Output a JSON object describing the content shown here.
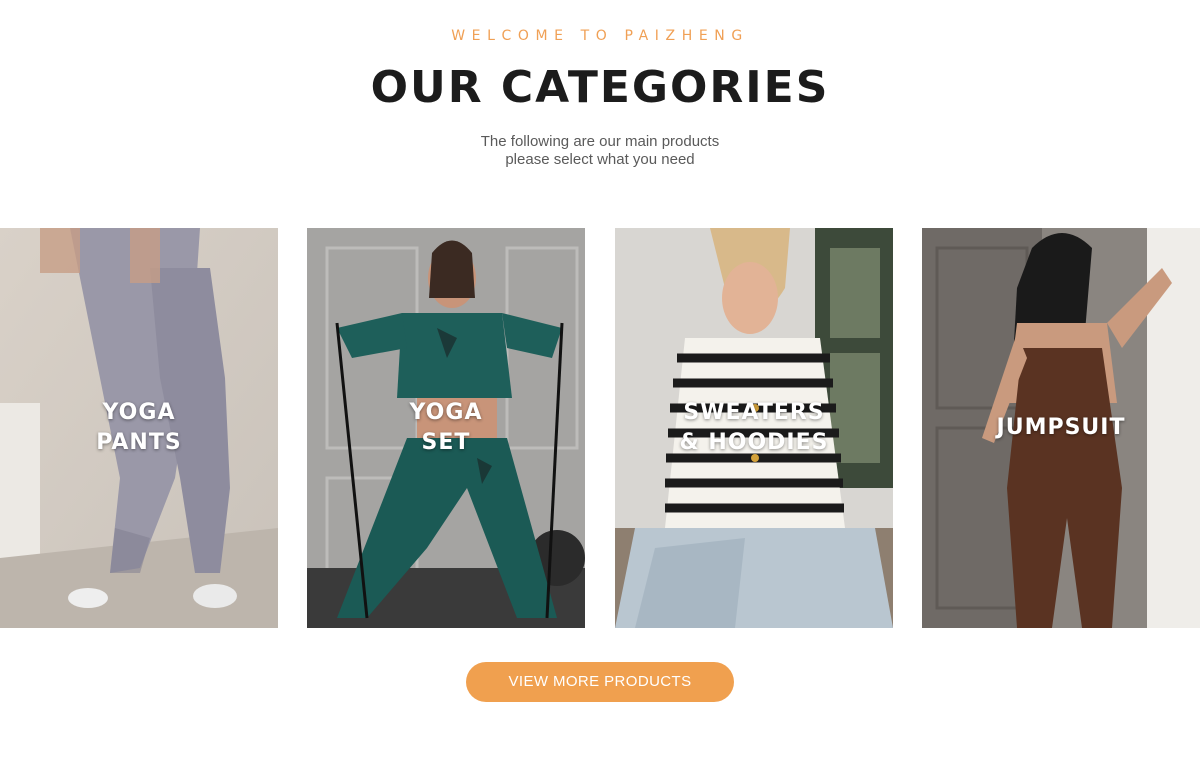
{
  "header": {
    "eyebrow": "WELCOME TO PAIZHENG",
    "title": "OUR CATEGORIES",
    "subtitle_line1": "The following are our main products",
    "subtitle_line2": "please select what you need"
  },
  "categories": [
    {
      "line1": "YOGA",
      "line2": "PANTS"
    },
    {
      "line1": "YOGA",
      "line2": "SET"
    },
    {
      "line1": "SWEATERS",
      "line2": "& HOODIES"
    },
    {
      "line1": "JUMPSUIT"
    }
  ],
  "cta": {
    "label": "VIEW MORE PRODUCTS"
  },
  "colors": {
    "accent": "#f0a04f",
    "title": "#1c1c1c",
    "text": "#5a5a5a"
  }
}
